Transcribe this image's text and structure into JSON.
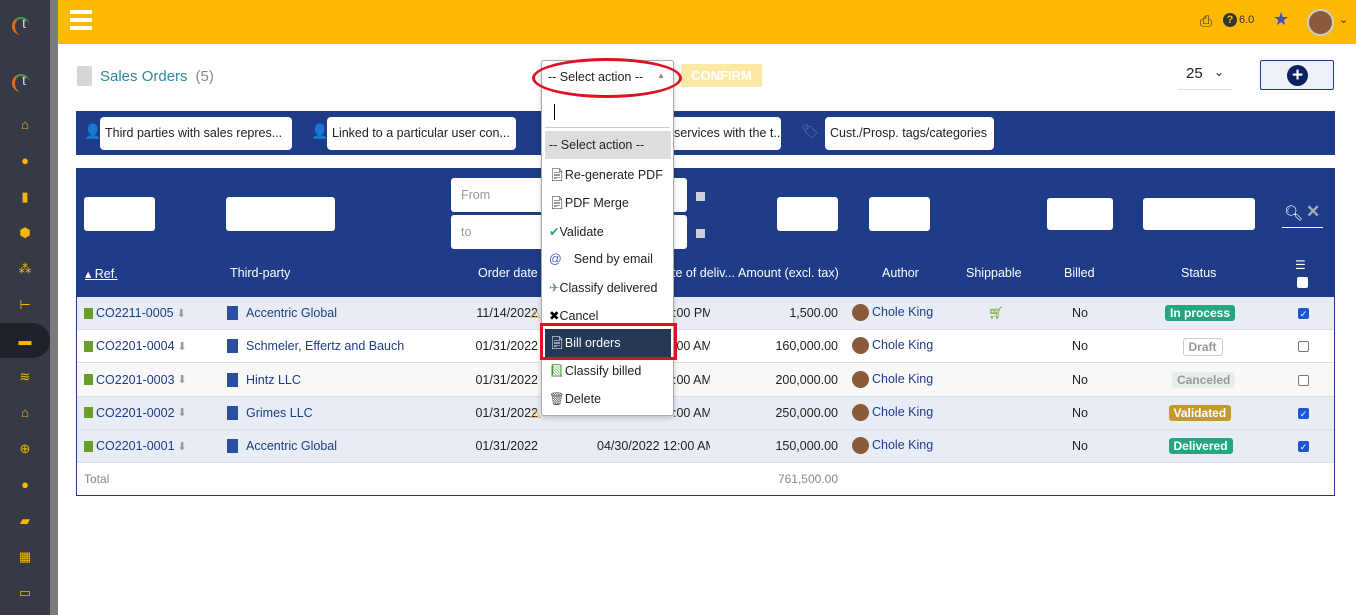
{
  "app": {
    "version": "6.0"
  },
  "header": {
    "title": "Sales Orders",
    "count": "(5)"
  },
  "action_select": {
    "value": "-- Select action --",
    "confirm": "CONFIRM",
    "options": [
      "-- Select action --",
      "Re-generate PDF",
      "PDF Merge",
      "Validate",
      "Send by email",
      "Classify delivered",
      "Cancel",
      "Bill orders",
      "Classify billed",
      "Delete"
    ],
    "highlighted": "Bill orders"
  },
  "page_size": "25",
  "filters": [
    "Third parties with sales repres...",
    "Linked to a particular user con...",
    "services with the t...",
    "Cust./Prosp. tags/categories"
  ],
  "date_filter": {
    "from": "From",
    "to": "to"
  },
  "columns": [
    "Ref.",
    "Third-party",
    "Order date",
    "Date of deliv...",
    "Amount (excl. tax)",
    "Author",
    "Shippable",
    "Billed",
    "Status"
  ],
  "rows": [
    {
      "ref": "CO2211-0005",
      "thirdparty": "Accentric Global",
      "order_date": "11/14/2022",
      "delivery": ":00 PM",
      "amount": "1,500.00",
      "author": "Chole King",
      "shippable": true,
      "billed": "No",
      "status": "In process",
      "checked": true,
      "warn": true
    },
    {
      "ref": "CO2201-0004",
      "thirdparty": "Schmeler, Effertz and Bauch",
      "order_date": "01/31/2022",
      "delivery": ":00 AM",
      "amount": "160,000.00",
      "author": "Chole King",
      "shippable": false,
      "billed": "No",
      "status": "Draft",
      "checked": false,
      "warn": false
    },
    {
      "ref": "CO2201-0003",
      "thirdparty": "Hintz LLC",
      "order_date": "01/31/2022",
      "delivery": ":00 AM",
      "amount": "200,000.00",
      "author": "Chole King",
      "shippable": false,
      "billed": "No",
      "status": "Canceled",
      "checked": false,
      "warn": false
    },
    {
      "ref": "CO2201-0002",
      "thirdparty": "Grimes LLC",
      "order_date": "01/31/2022",
      "delivery": ":00 AM",
      "amount": "250,000.00",
      "author": "Chole King",
      "shippable": false,
      "billed": "No",
      "status": "Validated",
      "checked": true,
      "warn": true
    },
    {
      "ref": "CO2201-0001",
      "thirdparty": "Accentric Global",
      "order_date": "01/31/2022",
      "delivery": "04/30/2022 12:00 AM",
      "amount": "150,000.00",
      "author": "Chole King",
      "shippable": false,
      "billed": "No",
      "status": "Delivered",
      "checked": true,
      "warn": false
    }
  ],
  "total": {
    "label": "Total",
    "amount": "761,500.00"
  },
  "colors": {
    "topbar": "#fdb900",
    "navy": "#1e3c87",
    "in_process": "#25a580",
    "validated": "#c39b2c",
    "delivered": "#25a580"
  }
}
